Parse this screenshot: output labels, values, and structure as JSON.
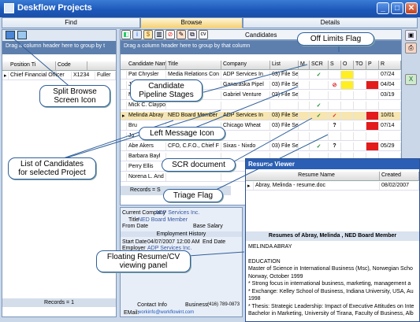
{
  "window": {
    "title": "Deskflow Projects"
  },
  "tabs": {
    "find": "Find",
    "browse": "Browse",
    "details": "Details"
  },
  "left": {
    "group_hint": "Drag a column header here to group by t",
    "columns": [
      "Position Ti",
      "Code"
    ],
    "rows": [
      {
        "position": "Chief Financial Officer",
        "code": "X1234",
        "extra": "Fuller"
      }
    ],
    "records": "Records = 1"
  },
  "candidates": {
    "title": "Candidates",
    "group_hint": "Drag a column header here to group by that column",
    "columns": [
      "Candidate Nam",
      "Title",
      "Company",
      "List",
      "M",
      "SCR",
      "S",
      "O",
      "TO",
      "P",
      "R"
    ],
    "rows": [
      {
        "name": "Pat Chrysler",
        "title": "Media Relations Con",
        "company": "ADP Services In",
        "list": "03) File Se",
        "date": "07/24"
      },
      {
        "name": "Jil",
        "title": "",
        "company": "Ganaraska Pipel",
        "list": "03) File Se",
        "date": "04/04"
      },
      {
        "name": "Mi",
        "title": "",
        "company": "Gabriel Venture",
        "list": "03) File Se",
        "date": "03/19"
      },
      {
        "name": "Mick C. Claypo",
        "title": "",
        "company": "",
        "list": "",
        "date": ""
      },
      {
        "name": "Melinda Abray",
        "title": "NED Board Member",
        "company": "ADP Services In",
        "list": "03) File Se",
        "date": "10/01"
      },
      {
        "name": "Bru",
        "title": "",
        "company": "Chicago Wheat",
        "list": "03) File Se",
        "date": "07/14"
      },
      {
        "name": "Jo",
        "title": "",
        "company": "",
        "list": "",
        "date": ""
      },
      {
        "name": "Abe Akers",
        "title": "CFO, C.F.O., Chief F",
        "company": "Sixas - Nixdo",
        "list": "03) File Se",
        "date": "05/29"
      },
      {
        "name": "Barbara Bayl",
        "title": "",
        "company": "",
        "list": "",
        "date": ""
      },
      {
        "name": "Perry Ellis",
        "title": "",
        "company": "",
        "list": "",
        "date": ""
      },
      {
        "name": "Norena L. And",
        "title": "",
        "company": "",
        "list": "",
        "date": ""
      }
    ],
    "records": "Records = S"
  },
  "detail": {
    "current_company_label": "Current Company",
    "current_company": "ADP Services Inc.",
    "title_label": "Title",
    "title": "NED Board Member",
    "from_date_label": "From Date",
    "base_salary_label": "Base Salary",
    "employment_history": "Employment History",
    "start_date_label": "Start Date",
    "start_date": "04/07/2007 12:00 AM",
    "end_date_label": "End Date",
    "employer_label": "Employer",
    "employer": "ADP Services Inc.",
    "contact_info": "Contact Info",
    "business_label": "Business:",
    "business": "(416) 789-0873",
    "email_label": "EMail:",
    "email": "workinfo@workflowint.com"
  },
  "resume_viewer": {
    "title": "Resume Viewer",
    "col_name": "Resume Name",
    "col_created": "Created",
    "file": "Abray, Melinda - resume.doc",
    "created": "08/02/2007",
    "header": "Resumes of Abray, Melinda , NED Board Member",
    "lines": [
      "MELINDA ABRAY",
      "",
      "EDUCATION",
      "Master of Science in International Business (Msc), Norwegian Scho",
      "Norway, October 1999",
      "* Strong focus in international business, marketing, management a",
      "* Exchange: Kelley School of Business, Indiana University, USA, Au",
      "1998",
      "* Thesis: Strategic Leadership: Impact of Executive Attitudes on Inte",
      "Bachelor in Marketing, University of Tirana, Faculty of Business, Alb"
    ]
  },
  "callouts": {
    "off_limits": "Off Limits Flag",
    "split_browse": "Split Browse\nScreen Icon",
    "pipeline": "Candidate\nPipeline Stages",
    "left_message": "Left Message Icon",
    "candidates_list": "List of Candidates\nfor selected Project",
    "scr_doc": "SCR document",
    "triage": "Triage Flag",
    "floating": "Floating Resume/CV\nviewing panel"
  },
  "toolbar_label": "cv",
  "colors": {
    "accent": "#1c57b8",
    "selected_row": "#f7e6b0",
    "yellow_flag": "#ffee22",
    "red_flag": "#e31b1b"
  }
}
